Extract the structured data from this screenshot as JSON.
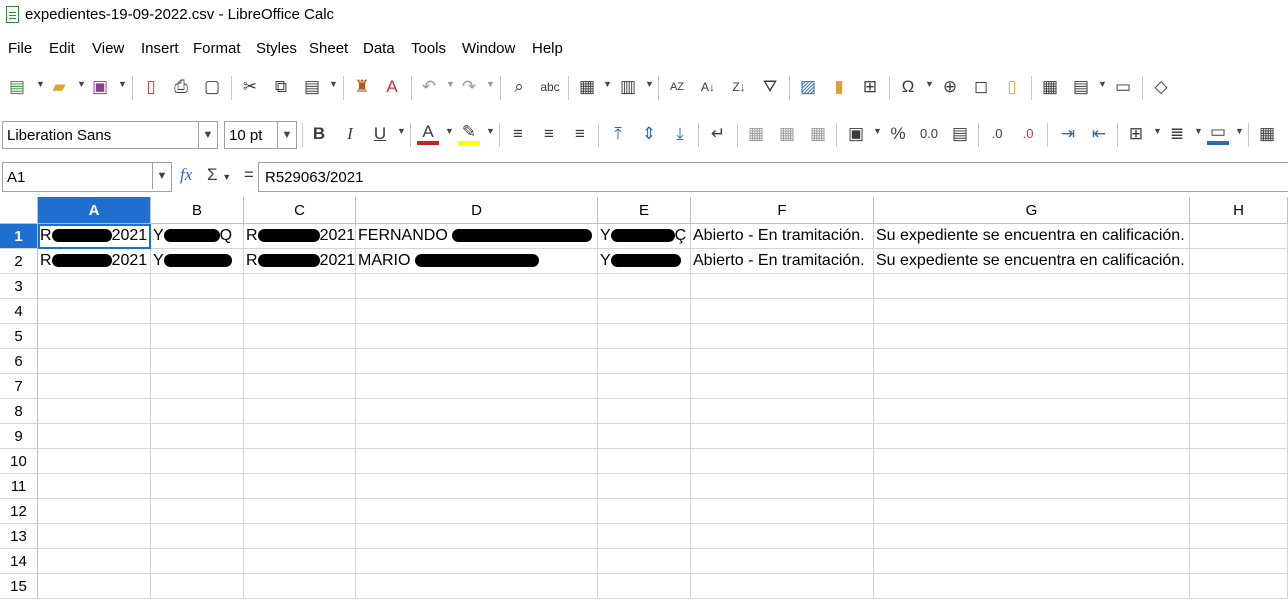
{
  "window": {
    "title": "expedientes-19-09-2022.csv - LibreOffice Calc"
  },
  "menu": [
    "File",
    "Edit",
    "View",
    "Insert",
    "Format",
    "Styles",
    "Sheet",
    "Data",
    "Tools",
    "Window",
    "Help"
  ],
  "toolbar2": {
    "font_name": "Liberation Sans",
    "font_size": "10 pt"
  },
  "formula_bar": {
    "cell_ref": "A1",
    "content": "R529063/2021",
    "fx": "fx",
    "sum": "Σ",
    "equals": "="
  },
  "columns": [
    "A",
    "B",
    "C",
    "D",
    "E",
    "F",
    "G",
    "H"
  ],
  "rows": [
    "1",
    "2",
    "3",
    "4",
    "5",
    "6",
    "7",
    "8",
    "9",
    "10",
    "11",
    "12",
    "13",
    "14",
    "15"
  ],
  "cells": {
    "r1": {
      "a1": "R",
      "a2": "2021",
      "b1": "Y",
      "b2": "Q",
      "c1": "R",
      "c2": "2021",
      "d": "FERNANDO",
      "e": "Y",
      "e2": "Ç",
      "f": "Abierto - En tramitación.",
      "g": "Su expediente se encuentra en calificación."
    },
    "r2": {
      "a1": "R",
      "a2": "2021",
      "b1": "Y",
      "c1": "R",
      "c2": "2021",
      "d": "MARIO",
      "e": "Y",
      "f": "Abierto - En tramitación.",
      "g": "Su expediente se encuentra en calificación."
    }
  },
  "colors": {
    "selection": "#1e6fd0",
    "redaction": "#000000"
  }
}
